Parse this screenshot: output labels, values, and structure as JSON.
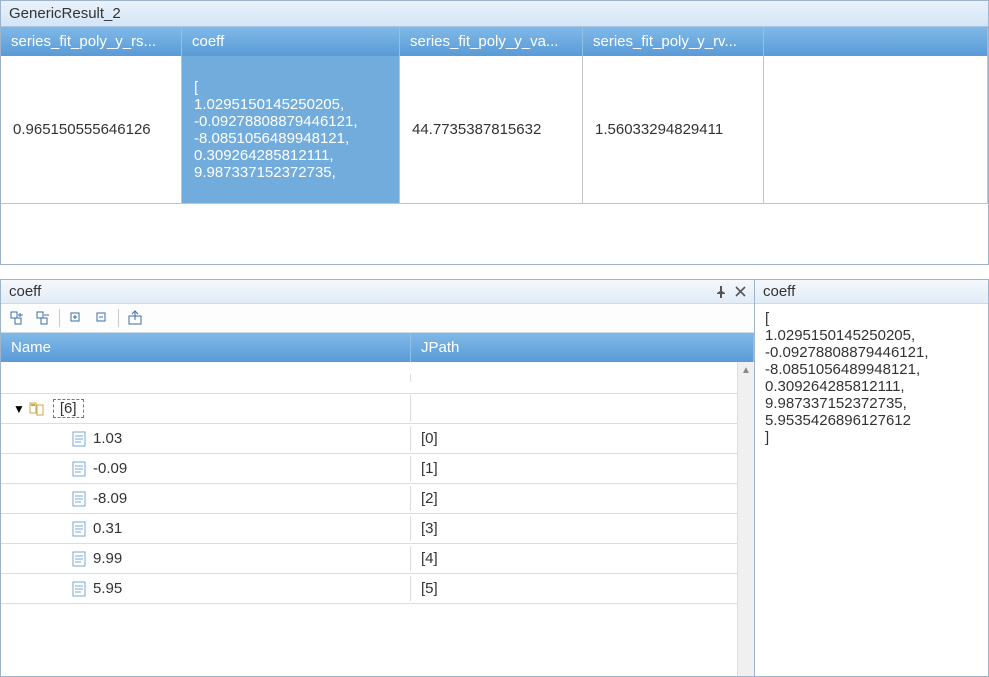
{
  "topPanel": {
    "title": "GenericResult_2",
    "columns": [
      "series_fit_poly_y_rs...",
      "coeff",
      "series_fit_poly_y_va...",
      "series_fit_poly_y_rv..."
    ],
    "row": {
      "c1": "0.965150555646126",
      "c2": "[\n  1.0295150145250205,\n  -0.09278808879446121,\n  -8.0851056489948121,\n  0.309264285812111,\n  9.987337152372735,",
      "c3": "44.7735387815632",
      "c4": "1.56033294829411"
    }
  },
  "leftPanel": {
    "title": "coeff",
    "headers": {
      "name": "Name",
      "jpath": "JPath"
    },
    "rootLabel": "[6]",
    "items": [
      {
        "value": "1.03",
        "jpath": "[0]"
      },
      {
        "value": "-0.09",
        "jpath": "[1]"
      },
      {
        "value": "-8.09",
        "jpath": "[2]"
      },
      {
        "value": "0.31",
        "jpath": "[3]"
      },
      {
        "value": "9.99",
        "jpath": "[4]"
      },
      {
        "value": "5.95",
        "jpath": "[5]"
      }
    ]
  },
  "rightPanel": {
    "title": "coeff",
    "text": "[\n  1.0295150145250205,\n  -0.09278808879446121,\n  -8.0851056489948121,\n  0.309264285812111,\n  9.987337152372735,\n  5.9535426896127612\n]"
  }
}
